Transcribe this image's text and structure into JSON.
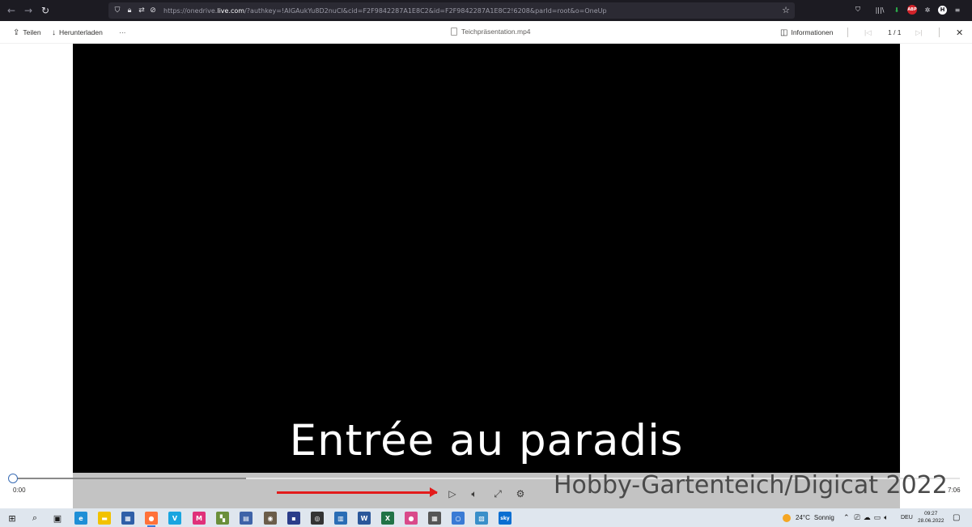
{
  "browser": {
    "url_prefix": "https://onedrive.",
    "url_domain": "live.com",
    "url_rest": "/?authkey=!AIGAukYu8D2nuCI&cid=F2F9842287A1E8C2&id=F2F9842287A1E8C2!6208&parId=root&o=OneUp",
    "extension_abp_label": "ABP",
    "extension_h_label": "H"
  },
  "toolbar": {
    "share_label": "Teilen",
    "download_label": "Herunterladen",
    "more_label": "···",
    "file_name": "Teichpräsentation.mp4",
    "info_label": "Informationen",
    "page_counter": "1 / 1"
  },
  "video": {
    "subtitle_text": "Entrée au paradis",
    "current_time": "0:00",
    "duration": "7:06",
    "progress_fraction": 0,
    "buffered_fraction": 0.246,
    "watermark": "Hobby-Gartenteich/Digicat 2022"
  },
  "taskbar": {
    "weather_temp": "24°C",
    "weather_text": "Sonnig",
    "language": "DEU",
    "time": "09:27",
    "date": "28.06.2022",
    "apps": [
      {
        "name": "windows-start",
        "color": "#1a1a1a",
        "glyph": "⊞"
      },
      {
        "name": "search",
        "color": "#1a1a1a",
        "glyph": "⌕"
      },
      {
        "name": "task-view",
        "color": "#1a1a1a",
        "glyph": "▣"
      },
      {
        "name": "edge",
        "color": "#1f8fd6",
        "glyph": "e"
      },
      {
        "name": "file-explorer",
        "color": "#f2c200",
        "glyph": "▬"
      },
      {
        "name": "store",
        "color": "#2f5fa8",
        "glyph": "▦"
      },
      {
        "name": "firefox",
        "color": "#ff7139",
        "glyph": "●"
      },
      {
        "name": "app-v",
        "color": "#19a5e0",
        "glyph": "V"
      },
      {
        "name": "app-m",
        "color": "#e0317a",
        "glyph": "M"
      },
      {
        "name": "app-tiles",
        "color": "#6a8f3a",
        "glyph": "▚"
      },
      {
        "name": "app-doc",
        "color": "#3e63a8",
        "glyph": "▤"
      },
      {
        "name": "app-gimp",
        "color": "#6b5d4a",
        "glyph": "◉"
      },
      {
        "name": "app-pc",
        "color": "#2b3d8a",
        "glyph": "▪"
      },
      {
        "name": "app-obs",
        "color": "#333333",
        "glyph": "◎"
      },
      {
        "name": "app-data",
        "color": "#2a6db5",
        "glyph": "▥"
      },
      {
        "name": "word",
        "color": "#2b579a",
        "glyph": "W"
      },
      {
        "name": "excel",
        "color": "#217346",
        "glyph": "X"
      },
      {
        "name": "app-ball",
        "color": "#d94a8a",
        "glyph": "●"
      },
      {
        "name": "app-film",
        "color": "#555555",
        "glyph": "▦"
      },
      {
        "name": "app-ring",
        "color": "#3a7bd5",
        "glyph": "○"
      },
      {
        "name": "app-grid",
        "color": "#3a8fc9",
        "glyph": "▧"
      },
      {
        "name": "app-sky",
        "color": "#0a6ed1",
        "glyph": "sky"
      }
    ]
  }
}
